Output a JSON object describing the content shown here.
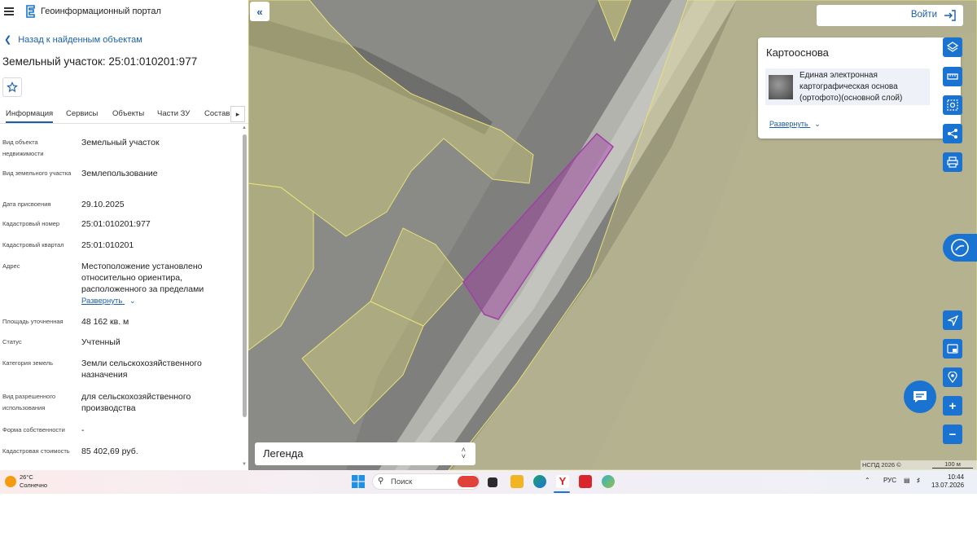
{
  "app": {
    "title": "Геоинформационный портал"
  },
  "nav": {
    "back": "Назад к найденным объектам"
  },
  "object": {
    "title": "Земельный участок: 25:01:010201:977"
  },
  "tabs": [
    "Информация",
    "Сервисы",
    "Объекты",
    "Части ЗУ",
    "Состав"
  ],
  "properties": [
    {
      "label": "Вид объекта недвижимости",
      "value": "Земельный участок"
    },
    {
      "label": "Вид земельного участка",
      "value": "Землепользование"
    },
    {
      "label": "Дата присвоения",
      "value": "29.10.2025"
    },
    {
      "label": "Кадастровый номер",
      "value": "25:01:010201:977"
    },
    {
      "label": "Кадастровый квартал",
      "value": "25:01:010201"
    },
    {
      "label": "Адрес",
      "value": "Местоположение установлено относительно ориентира, расположенного за пределами",
      "expand": "Развернуть"
    },
    {
      "label": "Площадь уточненная",
      "value": "48 162 кв. м"
    },
    {
      "label": "Статус",
      "value": "Учтенный"
    },
    {
      "label": "Категория земель",
      "value": "Земли сельскохозяйственного назначения"
    },
    {
      "label": "Вид разрешенного использования",
      "value": "для сельскохозяйственного производства"
    },
    {
      "label": "Форма собственности",
      "value": "-"
    },
    {
      "label": "Кадастровая стоимость",
      "value": "85 402,69 руб."
    }
  ],
  "map": {
    "login": "Войти",
    "basemap_title": "Картооснова",
    "basemap_layer": "Единая электронная картографическая основа (ортофото)(основной слой)",
    "basemap_expand": "Развернуть",
    "legend": "Легенда",
    "credits": "НСПД 2026 ©",
    "scale": "100 м",
    "parcel_color": "#a13fa6",
    "neighbor_color": "#e6e07a"
  },
  "taskbar": {
    "weather_temp": "26°C",
    "weather_desc": "Солнечно",
    "search": "Поиск",
    "lang": "РУС",
    "time": "10:44",
    "date": "13.07.2026"
  }
}
